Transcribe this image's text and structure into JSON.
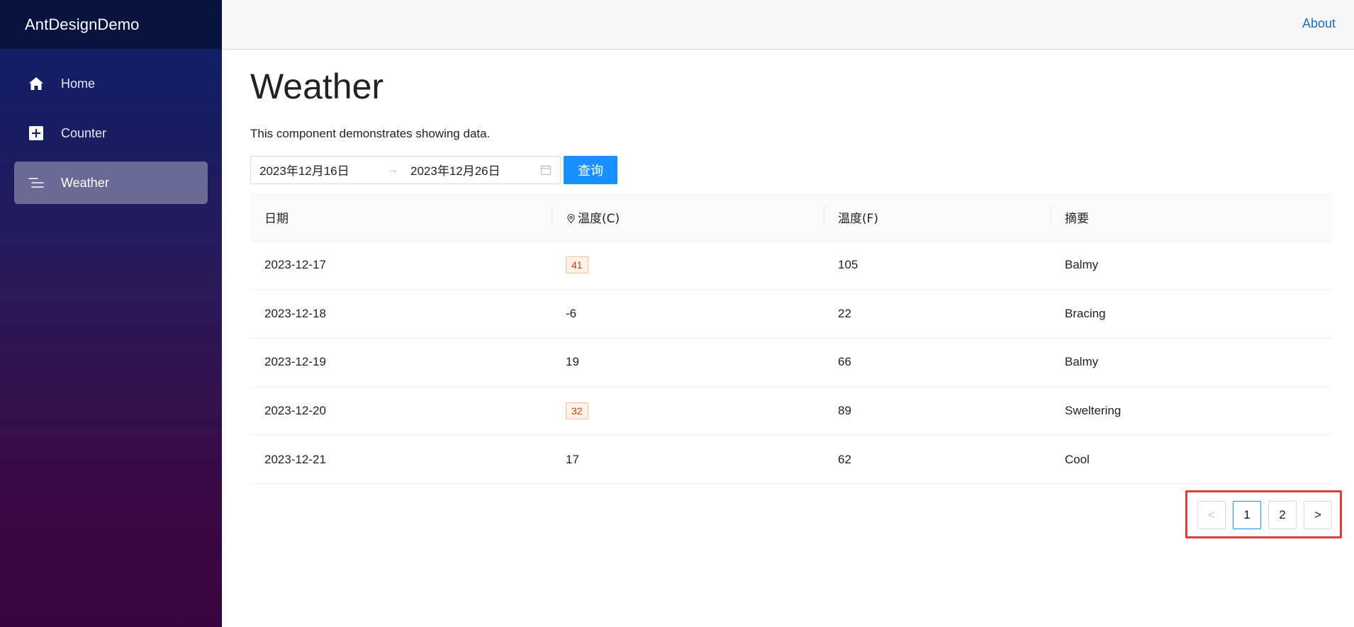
{
  "app": {
    "brand": "AntDesignDemo"
  },
  "sidebar": {
    "items": [
      {
        "label": "Home",
        "icon": "home-icon"
      },
      {
        "label": "Counter",
        "icon": "plus-square-icon"
      },
      {
        "label": "Weather",
        "icon": "list-icon",
        "active": true
      }
    ]
  },
  "topbar": {
    "about": "About"
  },
  "page": {
    "title": "Weather",
    "lead": "This component demonstrates showing data."
  },
  "filter": {
    "start_date": "2023年12月16日",
    "separator": "→",
    "end_date": "2023年12月26日",
    "query_label": "查询"
  },
  "table": {
    "headers": [
      "日期",
      "温度(C)",
      "温度(F)",
      "摘要"
    ],
    "rows": [
      {
        "date": "2023-12-17",
        "temp_c": "41",
        "temp_f": "105",
        "summary": "Balmy",
        "hot": true
      },
      {
        "date": "2023-12-18",
        "temp_c": "-6",
        "temp_f": "22",
        "summary": "Bracing",
        "hot": false
      },
      {
        "date": "2023-12-19",
        "temp_c": "19",
        "temp_f": "66",
        "summary": "Balmy",
        "hot": false
      },
      {
        "date": "2023-12-20",
        "temp_c": "32",
        "temp_f": "89",
        "summary": "Sweltering",
        "hot": true
      },
      {
        "date": "2023-12-21",
        "temp_c": "17",
        "temp_f": "62",
        "summary": "Cool",
        "hot": false
      }
    ]
  },
  "pagination": {
    "prev": "<",
    "pages": [
      "1",
      "2"
    ],
    "current": "1",
    "next": ">"
  },
  "colors": {
    "accent": "#1890ff",
    "tag_text": "#d4380d",
    "tag_bg": "#fff2e8",
    "highlight": "#e03b3b"
  }
}
